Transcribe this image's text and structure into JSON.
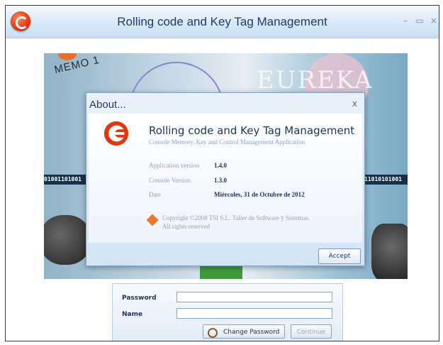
{
  "window": {
    "title": "Rolling code and Key Tag Management",
    "minimize_glyph": "–",
    "maximize_glyph": "▭",
    "close_glyph": "×"
  },
  "banner": {
    "memo_text": "MEMO 1",
    "logo_text": "EUREKA",
    "binary_left": "01001101001",
    "binary_right": "11010101001"
  },
  "about": {
    "title": "About...",
    "close_glyph": "x",
    "app_name": "Rolling code and Key Tag Management",
    "app_subtitle": "Console Memory, Key and Control Management Application",
    "app_version_label": "Application version",
    "app_version_value": "1.4.0",
    "console_version_label": "Console Version",
    "console_version_value": "1.3.0",
    "date_label": "Date",
    "date_value": "Miércoles, 31 de Octubre de 2012",
    "copyright_line1": "Copyright ©2008 TSI S.L. Taller de Software y Sistemas.",
    "copyright_line2": "All rights reserved",
    "accept_label": "Accept"
  },
  "login": {
    "password_label": "Password",
    "name_label": "Name",
    "password_value": "",
    "name_value": "",
    "change_password_label": "Change Password",
    "continue_label": "Continue"
  }
}
